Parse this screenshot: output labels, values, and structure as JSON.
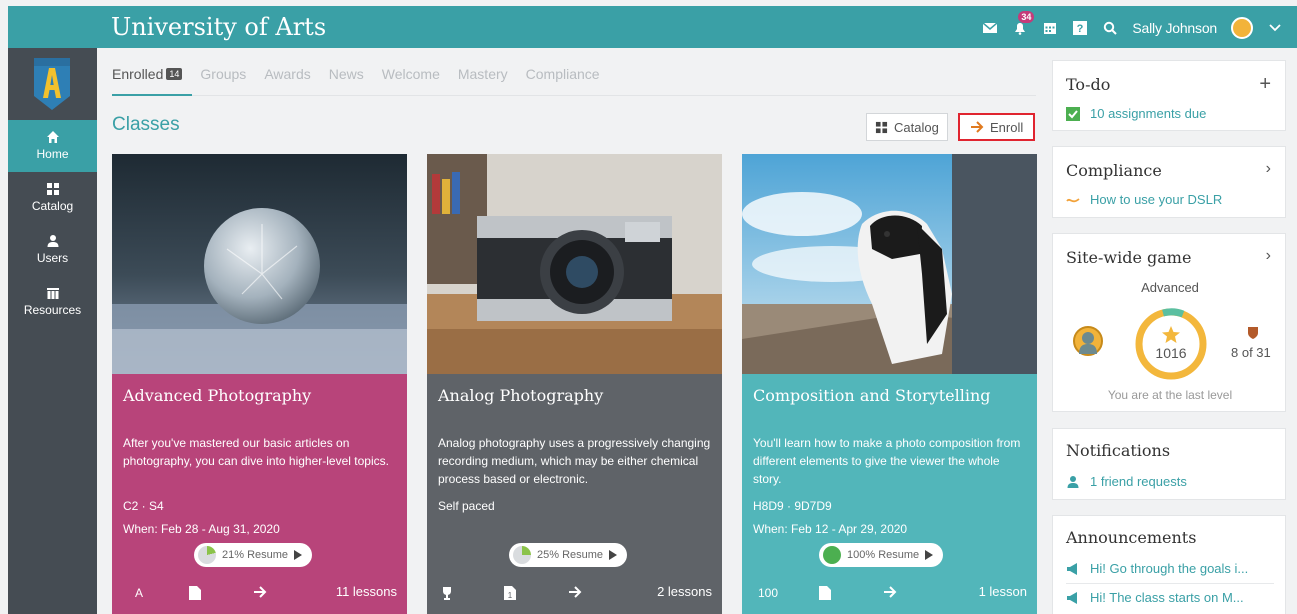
{
  "header": {
    "title": "University of Arts",
    "notification_count": "34",
    "user_name": "Sally Johnson"
  },
  "sidenav": {
    "items": [
      {
        "label": "Home",
        "icon": "home-icon",
        "active": true
      },
      {
        "label": "Catalog",
        "icon": "grid-icon",
        "active": false
      },
      {
        "label": "Users",
        "icon": "user-icon",
        "active": false
      },
      {
        "label": "Resources",
        "icon": "books-icon",
        "active": false
      }
    ]
  },
  "tabs": {
    "enrolled": "Enrolled",
    "enrolled_count": "14",
    "groups": "Groups",
    "awards": "Awards",
    "news": "News",
    "welcome": "Welcome",
    "mastery": "Mastery",
    "compliance": "Compliance"
  },
  "main": {
    "section_title": "Classes",
    "catalog_button": "Catalog",
    "enroll_button": "Enroll"
  },
  "classes": [
    {
      "title": "Advanced Photography",
      "description": "After you've mastered our basic articles on photography, you can dive into higher-level topics.",
      "code": "C2 · S4",
      "when": "When: Feb 28 - Aug 31, 2020",
      "progress_percent": 21,
      "resume_label": "21% Resume",
      "footer_first": "A",
      "lessons": "11 lessons"
    },
    {
      "title": "Analog Photography",
      "description": "Analog photography uses a progressively changing recording medium, which may be either chemical process based or electronic.",
      "code": "Self paced",
      "when": "",
      "progress_percent": 25,
      "resume_label": "25% Resume",
      "lessons": "2 lessons"
    },
    {
      "title": "Composition and Storytelling",
      "description": "You'll learn how to make a photo composition from different elements to give the viewer the whole story.",
      "code": "H8D9 · 9D7D9",
      "when": "When: Feb 12 - Apr 29, 2020",
      "progress_percent": 100,
      "resume_label": "100% Resume",
      "footer_first": "100",
      "lessons": "1 lesson"
    }
  ],
  "todo": {
    "title": "To-do",
    "link": "10 assignments due"
  },
  "compliance": {
    "title": "Compliance",
    "link": "How to use your DSLR"
  },
  "game": {
    "title": "Site-wide game",
    "level": "Advanced",
    "points": "1016",
    "rank": "8 of 31",
    "status": "You are at the last level"
  },
  "notifications": {
    "title": "Notifications",
    "link": "1 friend requests"
  },
  "announcements": {
    "title": "Announcements",
    "items": [
      "Hi! Go through the goals i...",
      "Hi! The class starts on M..."
    ]
  },
  "colors": {
    "brand": "#3aa0a6",
    "card1": "#b8447a",
    "card2": "#5f6368",
    "card3": "#52b6ba",
    "nav": "#454c53",
    "highlight_border": "#e0242f"
  }
}
